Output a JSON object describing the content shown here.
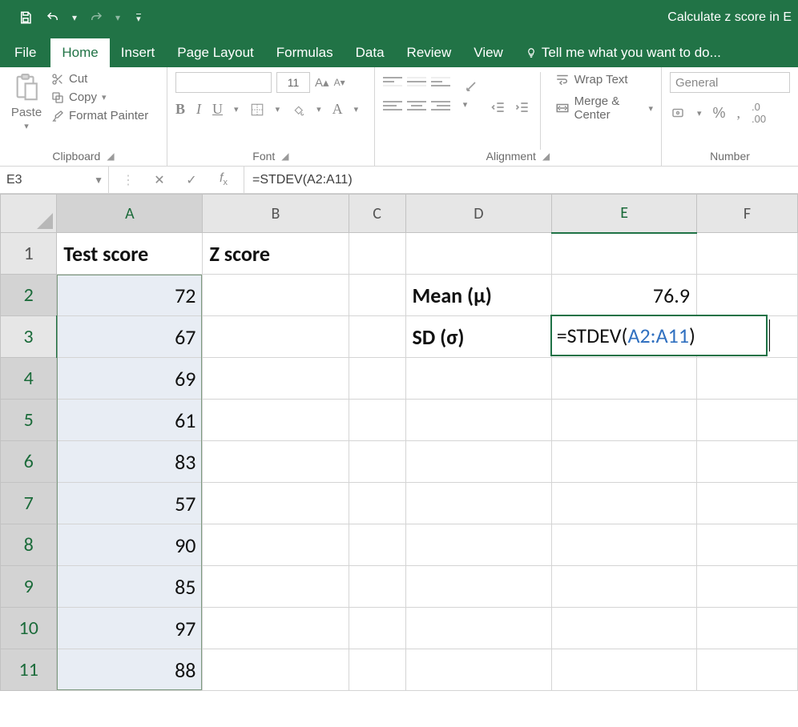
{
  "app_title": "Calculate z score in E",
  "tabs": {
    "file": "File",
    "home": "Home",
    "insert": "Insert",
    "page_layout": "Page Layout",
    "formulas": "Formulas",
    "data": "Data",
    "review": "Review",
    "view": "View",
    "tell_me": "Tell me what you want to do..."
  },
  "ribbon": {
    "clipboard": {
      "label": "Clipboard",
      "paste": "Paste",
      "cut": "Cut",
      "copy": "Copy",
      "format_painter": "Format Painter"
    },
    "font": {
      "label": "Font",
      "size": "11"
    },
    "alignment": {
      "label": "Alignment",
      "wrap_text": "Wrap Text",
      "merge_center": "Merge & Center"
    },
    "number": {
      "label": "Number",
      "format": "General"
    }
  },
  "name_box": "E3",
  "formula_bar": "=STDEV(A2:A11)",
  "columns": {
    "A": "A",
    "B": "B",
    "C": "C",
    "D": "D",
    "E": "E",
    "F": "F"
  },
  "rows": [
    "1",
    "2",
    "3",
    "4",
    "5",
    "6",
    "7",
    "8",
    "9",
    "10",
    "11"
  ],
  "cells": {
    "A1": "Test score",
    "B1": "Z score",
    "A2": "72",
    "A3": "67",
    "A4": "69",
    "A5": "61",
    "A6": "83",
    "A7": "57",
    "A8": "90",
    "A9": "85",
    "A10": "97",
    "A11": "88",
    "D2": "Mean (μ)",
    "E2": "76.9",
    "D3": "SD (σ)"
  },
  "editing_cell": {
    "prefix": "=STDEV(",
    "ref": "A2:A11",
    "suffix": ")"
  }
}
